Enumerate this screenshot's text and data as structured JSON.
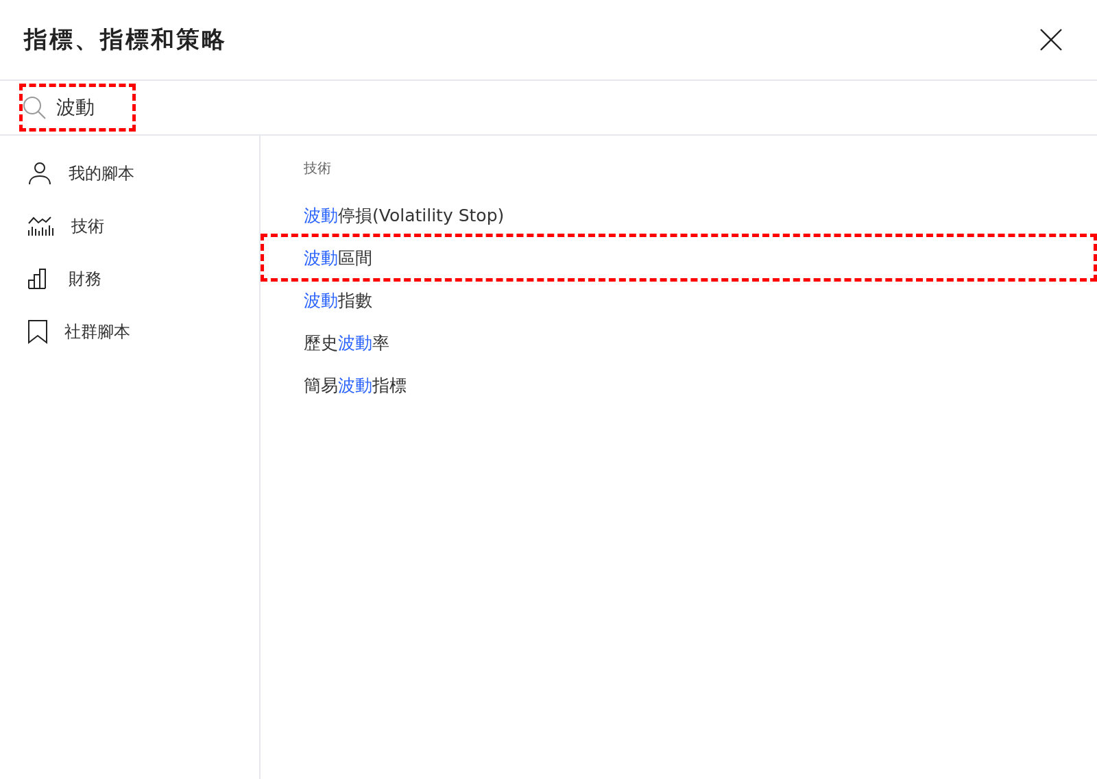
{
  "dialog": {
    "title": "指標、指標和策略"
  },
  "search": {
    "value": "波動",
    "annotated": true
  },
  "sidebar": {
    "items": [
      {
        "kind": "person",
        "label": "我的腳本"
      },
      {
        "kind": "technical",
        "label": "技術"
      },
      {
        "kind": "financial",
        "label": "財務"
      },
      {
        "kind": "bookmark",
        "label": "社群腳本"
      }
    ]
  },
  "results": {
    "section": "技術",
    "items": [
      {
        "annotated": false,
        "parts": [
          {
            "text": "波動",
            "match": true
          },
          {
            "text": "停損(Volatility Stop)",
            "match": false
          }
        ]
      },
      {
        "annotated": true,
        "parts": [
          {
            "text": "波動",
            "match": true
          },
          {
            "text": "區間",
            "match": false
          }
        ]
      },
      {
        "annotated": false,
        "parts": [
          {
            "text": "波動",
            "match": true
          },
          {
            "text": "指數",
            "match": false
          }
        ]
      },
      {
        "annotated": false,
        "parts": [
          {
            "text": "歷史",
            "match": false
          },
          {
            "text": "波動",
            "match": true
          },
          {
            "text": "率",
            "match": false
          }
        ]
      },
      {
        "annotated": false,
        "parts": [
          {
            "text": "簡易",
            "match": false
          },
          {
            "text": "波動",
            "match": true
          },
          {
            "text": "指標",
            "match": false
          }
        ]
      }
    ]
  }
}
